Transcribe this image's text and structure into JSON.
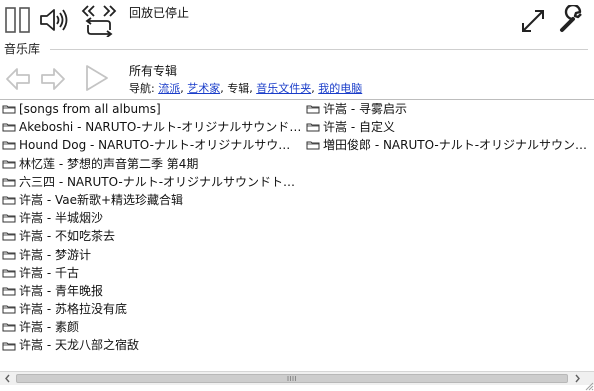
{
  "toolbar": {
    "status_text": "回放已停止",
    "icons": [
      "pause-icon",
      "volume-icon",
      "repeat-icon",
      "fullscreen-icon",
      "settings-wrench-icon"
    ]
  },
  "library": {
    "label": "音乐库"
  },
  "navigation": {
    "album_title": "所有专辑",
    "prefix": "导航: ",
    "links": [
      "流派",
      "艺术家"
    ],
    "current": "专辑",
    "links_after": [
      "音乐文件夹",
      "我的电脑"
    ],
    "separator": ", "
  },
  "albums": {
    "column1": [
      "[songs from all albums]",
      "Akeboshi - NARUTO-ナルト-オリジナルサウンドトラック",
      "Hound Dog - NARUTO-ナルト-オリジナルサウンドトラック",
      "林忆莲 - 梦想的声音第二季 第4期",
      "六三四 - NARUTO-ナルト-オリジナルサウンドトラック",
      "许嵩 - Vae新歌+精选珍藏合辑",
      "许嵩 - 半城烟沙",
      "许嵩 - 不如吃茶去",
      "许嵩 - 梦游计",
      "许嵩 - 千古",
      "许嵩 - 青年晚报",
      "许嵩 - 苏格拉没有底",
      "许嵩 - 素颜",
      "许嵩 - 天龙八部之宿敌"
    ],
    "column2": [
      "许嵩 - 寻雾启示",
      "许嵩 - 自定义",
      "増田俊郎 - NARUTO-ナルト-オリジナルサウンドトラック"
    ]
  },
  "colors": {
    "link": "#1a3dc9",
    "icon": "#333333",
    "icon_disabled": "#c8c8c8"
  }
}
